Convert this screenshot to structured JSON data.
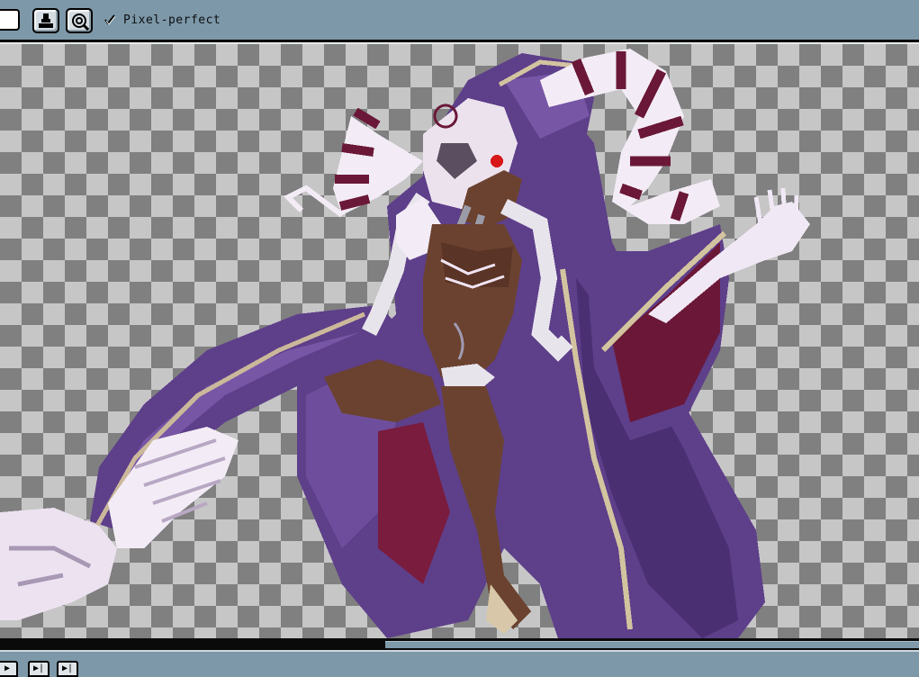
{
  "toolbar": {
    "pixel_perfect_label": "Pixel-perfect",
    "pixel_perfect_checked": true,
    "tools": [
      {
        "icon": "ink-shading-icon"
      },
      {
        "icon": "pixel-perfect-search-icon"
      }
    ]
  },
  "canvas": {
    "background": "checkerboard",
    "checker_colors": [
      "#808080",
      "#c6c6c6"
    ],
    "sprite": "hooded-sorceress-with-striped-horns"
  },
  "playback": {
    "buttons": [
      {
        "icon": "play-icon",
        "glyph": "▶"
      },
      {
        "icon": "next-frame-icon",
        "glyph": "▶|"
      },
      {
        "icon": "last-frame-icon",
        "glyph": "▶|"
      }
    ]
  },
  "colors": {
    "chrome": "#7d98a8",
    "robe_purple": "#5e3f8a",
    "robe_dark": "#3d2460",
    "horn_maroon": "#6b1838",
    "skin": "#6b4230",
    "bone": "#f0e8f4"
  }
}
